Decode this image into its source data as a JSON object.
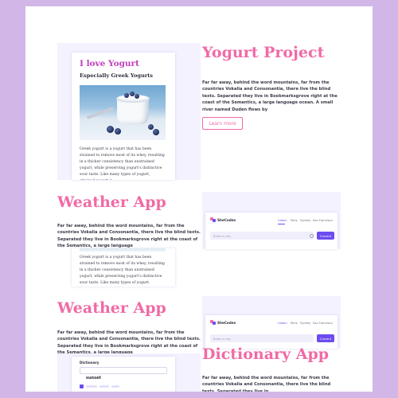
{
  "yogurt_card": {
    "heading": "I love Yogurt",
    "subheading": "Especially Greek Yogurts",
    "body": "Greek yogurt is a yogurt that has been strained to remove most of its whey, resulting in a thicker consistency than unstrained yogurt, while preserving yogurt's distinctive sour taste. Like many types of yogurt, strained yogurt is"
  },
  "yogurt_project": {
    "title": "Yogurt Project",
    "description": "Far far away, behind the word mountains, far from the countries Vokalia and Consonantia, there live the blind texts. Separated they live in Bookmarksgrove right at the coast of the Semantics, a large language ocean. A small river named Duden flows by",
    "button": "Learn more"
  },
  "weather_app": {
    "title": "Weather App",
    "description": "Far far away, behind the word mountains, far from the countries Vokalia and Consonantia, there live the blind texts. Separated they live in Bookmarksgrove right at the coast of the Semantics, a large language"
  },
  "weather_preview": {
    "brand": "SheCodes",
    "nav": [
      "Lisbon",
      "Paris",
      "Sydney",
      "San Francisco"
    ],
    "search_placeholder": "Enter a city",
    "search_button": "Current"
  },
  "repeat_card": {
    "body": "Greek yogurt is a yogurt that has been strained to remove most of its whey, resulting in a thicker consistency than unstrained yogurt, while preserving yogurt's distinctive sour taste. Like many types of yogurt, strained yogurt is"
  },
  "weather_app_2": {
    "title": "Weather App",
    "description": "Far far away, behind the word mountains, far from the countries Vokalia and Consonantia, there live the blind texts. Separated they live in Bookmarksgrove right at the coast of the Semantics, a large language"
  },
  "dictionary_app": {
    "title": "Dictionary App",
    "description": "Far far away, behind the word mountains, far from the countries Vokalia and Consonantia, there live the blind texts. Separated they live in"
  },
  "dictionary_preview": {
    "heading": "Dictionary",
    "word": "sunset"
  },
  "colors": {
    "background": "#d2b6e7",
    "accent_pink": "#f06aa6",
    "accent_purple": "#6c4cf0",
    "panel_lavender": "#f4f2ff"
  }
}
